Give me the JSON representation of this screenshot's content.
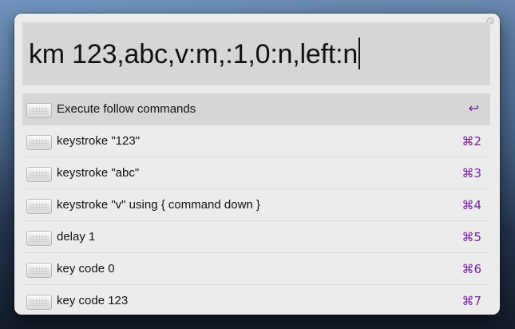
{
  "query": {
    "text": "km 123,abc,v:m,:1,0:n,left:n"
  },
  "settings_icon": "gear-icon",
  "colors": {
    "accent": "#7a1f9c",
    "selection": "#d6d6d6",
    "window_bg": "#ececec"
  },
  "results": [
    {
      "label": "Execute follow commands",
      "shortcut": "↩",
      "icon": "keyboard-icon",
      "selected": true
    },
    {
      "label": "keystroke \"123\"",
      "shortcut": "⌘2",
      "icon": "keyboard-icon"
    },
    {
      "label": "keystroke \"abc\"",
      "shortcut": "⌘3",
      "icon": "keyboard-icon"
    },
    {
      "label": "keystroke \"v\" using { command down }",
      "shortcut": "⌘4",
      "icon": "keyboard-icon"
    },
    {
      "label": "delay 1",
      "shortcut": "⌘5",
      "icon": "keyboard-icon"
    },
    {
      "label": "key code 0",
      "shortcut": "⌘6",
      "icon": "keyboard-icon"
    },
    {
      "label": "key code 123",
      "shortcut": "⌘7",
      "icon": "keyboard-icon"
    }
  ]
}
